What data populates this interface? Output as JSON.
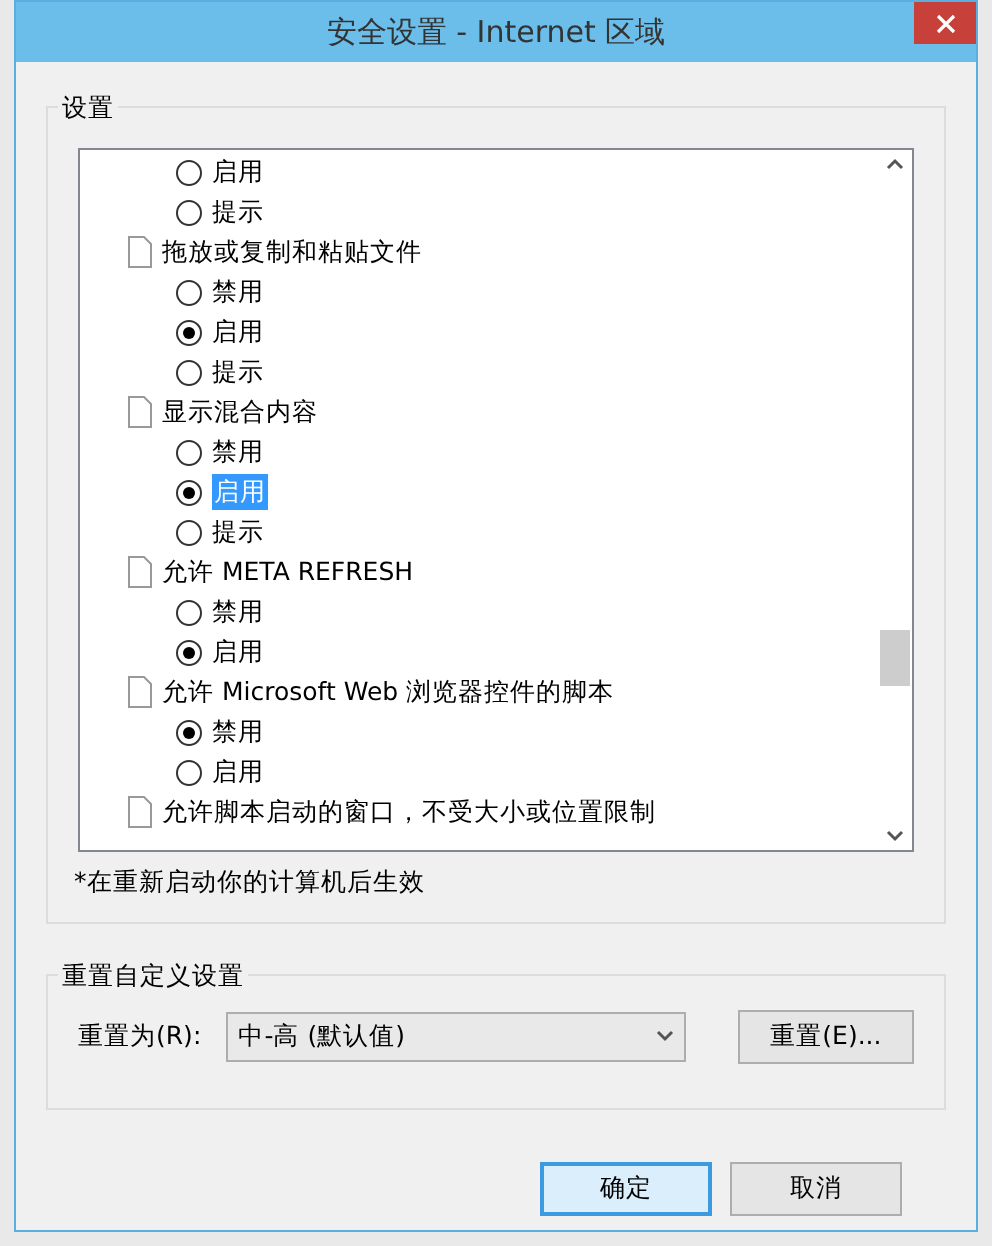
{
  "window": {
    "title": "安全设置 - Internet 区域"
  },
  "settings": {
    "legend": "设置",
    "items": [
      {
        "kind": "radio",
        "label": "启用",
        "selected": false,
        "highlighted": false
      },
      {
        "kind": "radio",
        "label": "提示",
        "selected": false,
        "highlighted": false
      },
      {
        "kind": "header",
        "label": "拖放或复制和粘贴文件"
      },
      {
        "kind": "radio",
        "label": "禁用",
        "selected": false,
        "highlighted": false
      },
      {
        "kind": "radio",
        "label": "启用",
        "selected": true,
        "highlighted": false
      },
      {
        "kind": "radio",
        "label": "提示",
        "selected": false,
        "highlighted": false
      },
      {
        "kind": "header",
        "label": "显示混合内容"
      },
      {
        "kind": "radio",
        "label": "禁用",
        "selected": false,
        "highlighted": false
      },
      {
        "kind": "radio",
        "label": "启用",
        "selected": true,
        "highlighted": true
      },
      {
        "kind": "radio",
        "label": "提示",
        "selected": false,
        "highlighted": false
      },
      {
        "kind": "header",
        "label": "允许 META REFRESH"
      },
      {
        "kind": "radio",
        "label": "禁用",
        "selected": false,
        "highlighted": false
      },
      {
        "kind": "radio",
        "label": "启用",
        "selected": true,
        "highlighted": false
      },
      {
        "kind": "header",
        "label": "允许 Microsoft Web 浏览器控件的脚本"
      },
      {
        "kind": "radio",
        "label": "禁用",
        "selected": true,
        "highlighted": false
      },
      {
        "kind": "radio",
        "label": "启用",
        "selected": false,
        "highlighted": false
      },
      {
        "kind": "header",
        "label": "允许脚本启动的窗口，不受大小或位置限制"
      }
    ],
    "note": "*在重新启动你的计算机后生效"
  },
  "reset": {
    "legend": "重置自定义设置",
    "label": "重置为(R):",
    "dropdown": "中-高 (默认值)",
    "button": "重置(E)..."
  },
  "buttons": [
    {
      "label": "确定",
      "default": true
    },
    {
      "label": "取消",
      "default": false
    }
  ]
}
